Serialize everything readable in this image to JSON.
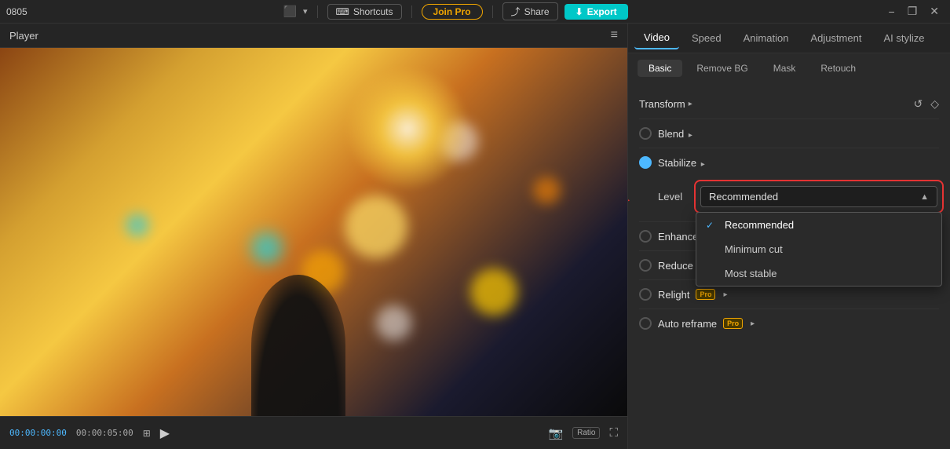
{
  "titlebar": {
    "title": "0805",
    "monitor_icon": "🖥",
    "shortcuts_label": "Shortcuts",
    "join_pro_label": "Join Pro",
    "share_label": "Share",
    "export_label": "Export",
    "minimize": "−",
    "maximize": "❐",
    "close": "✕"
  },
  "player": {
    "title": "Player",
    "time_current": "00:00:00:00",
    "time_total": "00:00:05:00",
    "play_icon": "▶"
  },
  "right_panel": {
    "tabs": [
      {
        "label": "Video",
        "active": true
      },
      {
        "label": "Speed",
        "active": false
      },
      {
        "label": "Animation",
        "active": false
      },
      {
        "label": "Adjustment",
        "active": false
      },
      {
        "label": "AI stylize",
        "active": false
      }
    ],
    "sub_tabs": [
      {
        "label": "Basic",
        "active": true
      },
      {
        "label": "Remove BG",
        "active": false
      },
      {
        "label": "Mask",
        "active": false
      },
      {
        "label": "Retouch",
        "active": false
      }
    ],
    "transform_label": "Transform",
    "blend_label": "Blend",
    "stabilize_label": "Stabilize",
    "level_label": "Level",
    "enhance_label": "Enhance",
    "reduce_label": "Reduce",
    "relight_label": "Relight",
    "autoreframe_label": "Auto reframe",
    "dropdown": {
      "selected": "Recommended",
      "options": [
        {
          "value": "Recommended",
          "selected": true
        },
        {
          "value": "Minimum cut",
          "selected": false
        },
        {
          "value": "Most stable",
          "selected": false
        }
      ]
    }
  }
}
